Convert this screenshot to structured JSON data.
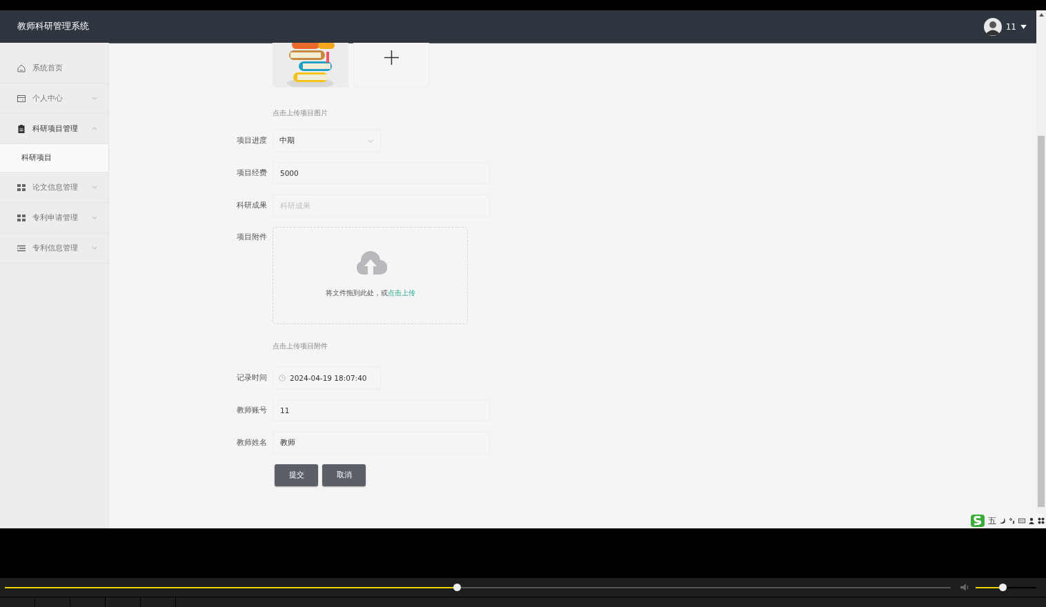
{
  "header": {
    "title": "教师科研管理系统",
    "user": "11"
  },
  "sidebar": {
    "items": [
      {
        "label": "系统首页"
      },
      {
        "label": "个人中心",
        "expanded": false
      },
      {
        "label": "科研项目管理",
        "expanded": true,
        "children": [
          {
            "label": "科研项目",
            "selected": true
          }
        ]
      },
      {
        "label": "论文信息管理",
        "expanded": false
      },
      {
        "label": "专利申请管理",
        "expanded": false
      },
      {
        "label": "专利信息管理",
        "expanded": false
      }
    ]
  },
  "form": {
    "fields": [
      {
        "kind": "image_upload",
        "hint": "点击上传项目图片"
      },
      {
        "kind": "select",
        "label": "项目进度",
        "value": "中期"
      },
      {
        "kind": "input",
        "label": "项目经费",
        "value": "5000"
      },
      {
        "kind": "input",
        "label": "科研成果",
        "placeholder": "科研成果"
      },
      {
        "kind": "dragger",
        "label": "项目附件",
        "text": "将文件拖到此处，或",
        "link": "点击上传",
        "hint": "点击上传项目附件"
      },
      {
        "kind": "datetime",
        "label": "记录时间",
        "value": "2024-04-19 18:07:40"
      },
      {
        "kind": "input",
        "label": "教师账号",
        "value": "11"
      },
      {
        "kind": "input",
        "label": "教师姓名",
        "value": "教师"
      }
    ],
    "buttons": [
      "提交",
      "取消"
    ]
  },
  "ime": {
    "mode": "五"
  },
  "player": {
    "progress": {
      "level": 0.478
    },
    "volume": {
      "level": 0.44
    }
  }
}
